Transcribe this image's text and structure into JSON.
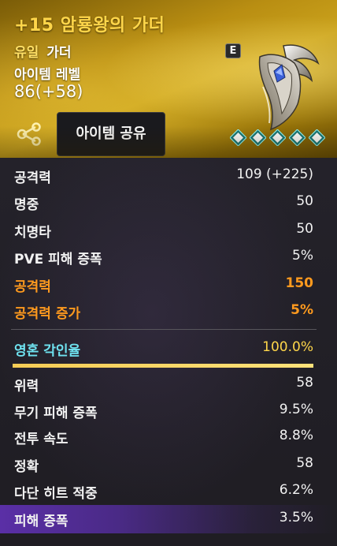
{
  "item": {
    "title": "+15 암룡왕의 가더",
    "grade": "유일",
    "type": "가더",
    "level_label": "아이템 레벨",
    "level_value": "86(+58)",
    "badge": "E",
    "weapon_icon": "guarder-weapon-icon",
    "enchant_stars": 5
  },
  "share": {
    "icon": "share-icon",
    "tooltip": "아이템 공유"
  },
  "colors": {
    "header_gold": "#caa21c",
    "title": "#ffd64a",
    "orange_stat": "#ff9a1e",
    "soul_stat": "#6fe3f0",
    "highlight_purple": "#5a2fa6"
  },
  "base_stats": [
    {
      "label": "공격력",
      "value": "109 (+225)"
    },
    {
      "label": "명중",
      "value": "50"
    },
    {
      "label": "치명타",
      "value": "50"
    },
    {
      "label": "PVE 피해 증폭",
      "value": "5%"
    }
  ],
  "bonus_stats": [
    {
      "label": "공격력",
      "value": "150"
    },
    {
      "label": "공격력 증가",
      "value": "5%"
    }
  ],
  "soul": {
    "label": "영혼 각인율",
    "value": "100.0%",
    "progress": 1.0
  },
  "soul_stats": [
    {
      "label": "위력",
      "value": "58"
    },
    {
      "label": "무기 피해 증폭",
      "value": "9.5%"
    },
    {
      "label": "전투 속도",
      "value": "8.8%"
    },
    {
      "label": "정확",
      "value": "58"
    },
    {
      "label": "다단 히트 적중",
      "value": "6.2%"
    },
    {
      "label": "피해 증폭",
      "value": "3.5%"
    }
  ]
}
